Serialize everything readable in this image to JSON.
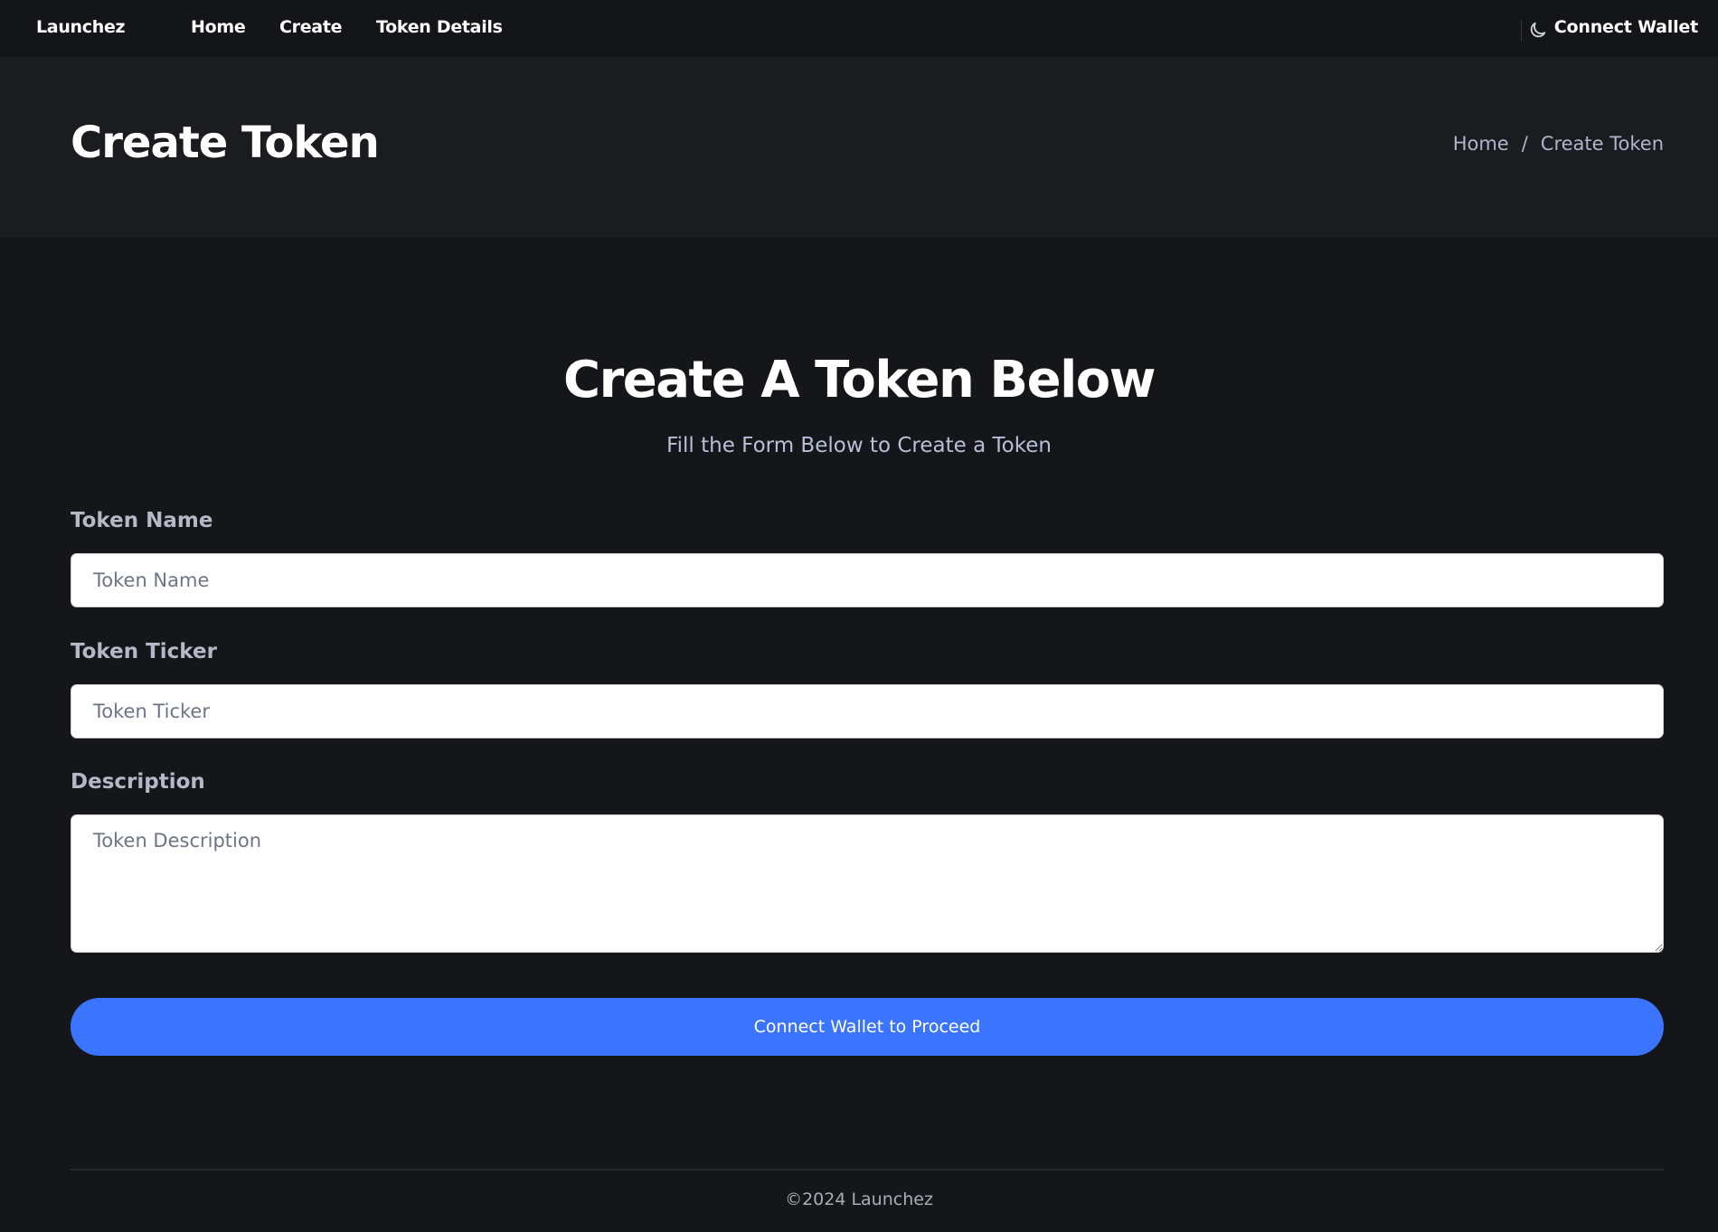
{
  "nav": {
    "brand": "Launchez",
    "links": [
      "Home",
      "Create",
      "Token Details"
    ],
    "theme_icon": "moon-icon",
    "connect_wallet": "Connect Wallet"
  },
  "banner": {
    "title": "Create Token",
    "breadcrumb": [
      "Home",
      "/",
      "Create Token"
    ]
  },
  "form": {
    "title": "Create A Token Below",
    "subtitle": "Fill the Form Below to Create a Token",
    "fields": [
      {
        "label": "Token Name",
        "placeholder": "Token Name",
        "value": ""
      },
      {
        "label": "Token Ticker",
        "placeholder": "Token Ticker",
        "value": ""
      },
      {
        "label": "Description",
        "placeholder": "Token Description",
        "value": ""
      }
    ],
    "submit": "Connect Wallet to Proceed",
    "accent": "#3a74ff"
  },
  "footer": {
    "text": "©2024 Launchez"
  }
}
